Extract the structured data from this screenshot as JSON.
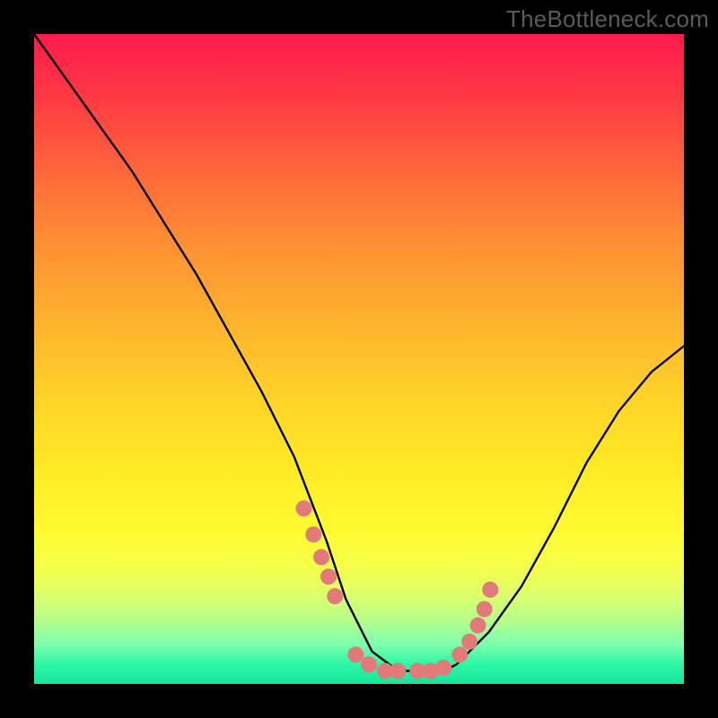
{
  "watermark": "TheBottleneck.com",
  "chart_data": {
    "type": "line",
    "title": "",
    "xlabel": "",
    "ylabel": "",
    "x_range": [
      0,
      100
    ],
    "y_range": [
      0,
      100
    ],
    "series": [
      {
        "name": "curve",
        "x": [
          0,
          5,
          10,
          15,
          20,
          25,
          30,
          35,
          40,
          45,
          48,
          52,
          56,
          60,
          63,
          65,
          70,
          75,
          80,
          85,
          90,
          95,
          100
        ],
        "y": [
          100,
          93,
          86,
          79,
          71,
          63,
          54,
          45,
          35,
          22,
          13,
          5,
          2,
          2,
          2,
          3,
          8,
          15,
          24,
          34,
          42,
          48,
          52
        ]
      }
    ],
    "markers": {
      "name": "highlight-dots",
      "x": [
        41.5,
        43.0,
        44.2,
        45.3,
        46.3,
        49.5,
        51.5,
        54.0,
        56.0,
        59.0,
        61.0,
        63.0,
        65.5,
        67.0,
        68.3,
        69.3,
        70.2
      ],
      "y": [
        27.0,
        23.0,
        19.5,
        16.5,
        13.5,
        4.5,
        3.0,
        2.0,
        2.0,
        2.0,
        2.0,
        2.5,
        4.5,
        6.5,
        9.0,
        11.5,
        14.5
      ]
    },
    "gradient_stops": [
      {
        "pct": 0,
        "color": "#ff1a4b"
      },
      {
        "pct": 50,
        "color": "#ffd328"
      },
      {
        "pct": 80,
        "color": "#fffb30"
      },
      {
        "pct": 100,
        "color": "#14e59c"
      }
    ]
  }
}
